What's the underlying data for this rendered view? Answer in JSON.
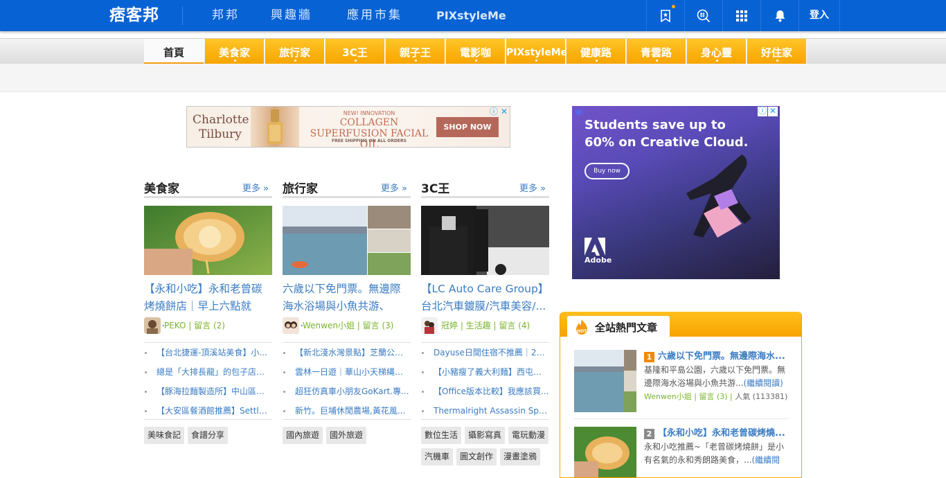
{
  "header": {
    "logo": "痞客邦",
    "nav": [
      "邦邦",
      "興趣牆",
      "應用市集",
      "PIXstyleMe"
    ],
    "tools": [
      "bookmark-icon",
      "hashtag-search-icon",
      "apps-grid-icon",
      "bell-icon"
    ],
    "login_label": "登入"
  },
  "categories": [
    "首頁",
    "美食家",
    "旅行家",
    "3C王",
    "親子王",
    "電影咖",
    "PIXstyleMe",
    "健康路",
    "青雲路",
    "身心靈",
    "好住家"
  ],
  "banner_ad": {
    "brand": "Charlotte Tilbury",
    "tagline": "NEW! INNOVATION",
    "headline": "COLLAGEN SUPERFUSION FACIAL OIL",
    "shipping": "FREE SHIPPING ON ALL ORDERS",
    "cta": "SHOP NOW"
  },
  "columns": [
    {
      "title": "美食家",
      "more": "更多 »",
      "article": "【永和小吃】永和老曾碳烤燒餅店｜早上六點就營...",
      "author": "PEKO",
      "comments": "留言 (2)",
      "links": [
        "【台北捷運-頂溪站美食】小...",
        "總是「大排長龍」的包子店！...",
        "【豚海拉麵製造所】中山區拉...",
        "【大安區餐酒館推薦】Settle ..."
      ],
      "tags": [
        "美味食記",
        "食譜分享"
      ]
    },
    {
      "title": "旅行家",
      "more": "更多 »",
      "article": "六歲以下免門票。無邊際海水浴場與小魚共游、賞...",
      "author": "Wenwen小姐",
      "comments": "留言 (3)",
      "links": [
        "【新北淺水灣景點】芝蘭公園...",
        "雲林一日遊｜華山小天梯縄索...",
        "超狂仿真車小朋友GoKart.專...",
        "新竹。巨埔休閒農場,黃花風..."
      ],
      "tags": [
        "國內旅遊",
        "國外旅遊"
      ]
    },
    {
      "title": "3C王",
      "more": "更多 »",
      "article": "【LC Auto Care Group】台北汽車鍍膜/汽車美容/...",
      "author": "冠婷",
      "category": "生活趣",
      "comments": "留言 (4)",
      "links": [
        "Dayuse日間住宿不推薦｜20...",
        "【小豬瘦了義大利麵】西屯聚...",
        "【Office版本比較】我應該買...",
        "Thermalright Assassin Spirit ..."
      ],
      "tags": [
        "數位生活",
        "攝影寫真",
        "電玩動漫",
        "汽機車",
        "圖文創作",
        "漫畫塗鴉"
      ]
    }
  ],
  "side_ad": {
    "headline": "Students save up to 60% on Creative Cloud.",
    "cta": "Buy now",
    "brand": "Adobe"
  },
  "hot": {
    "title": "全站熱門文章",
    "items": [
      {
        "rank": "1",
        "title": "六歲以下免門票。無邊際海水...",
        "desc": "基隆和平島公園，六歲以下免門票。無邊際海水浴場與小魚共游...",
        "read_more": "(繼續閱讀)",
        "author": "Wenwen小姐",
        "comments": "留言 (3)",
        "popularity": "人氣 (113381)"
      },
      {
        "rank": "2",
        "title": "【永和小吃】永和老曾碳烤燒...",
        "desc": "永和小吃推薦~「老曾碳烤燒餅」是小有名氣的永和秀朗路美食，...",
        "read_more": "(繼續閱"
      }
    ]
  }
}
